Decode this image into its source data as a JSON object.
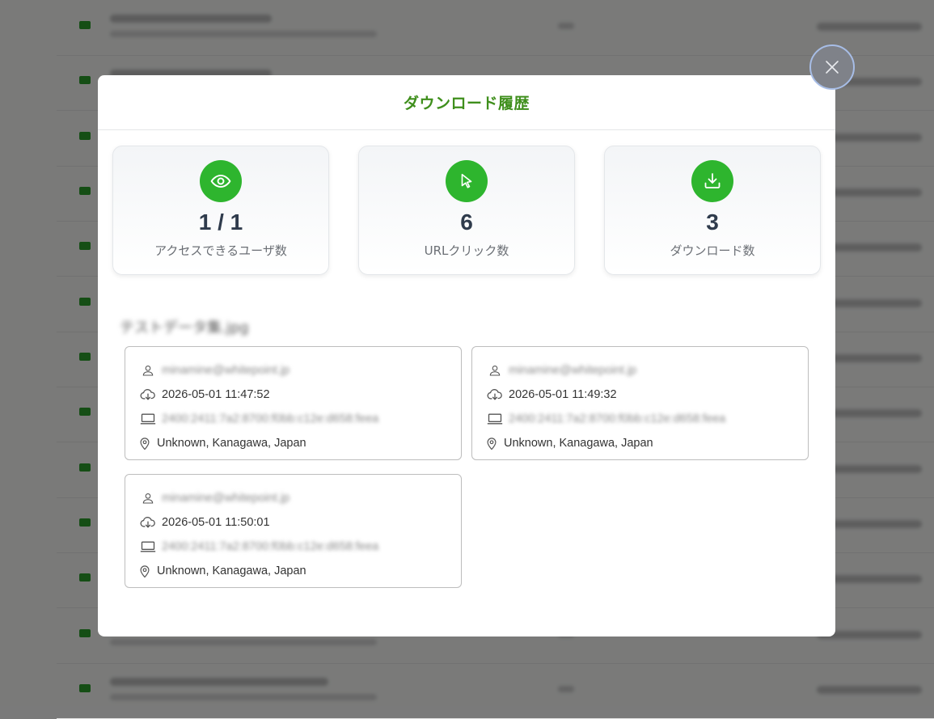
{
  "modal": {
    "title": "ダウンロード履歴"
  },
  "stats": [
    {
      "icon": "eye-icon",
      "value": "1 / 1",
      "label": "アクセスできるユーザ数"
    },
    {
      "icon": "cursor-icon",
      "value": "6",
      "label": "URLクリック数"
    },
    {
      "icon": "download-icon",
      "value": "3",
      "label": "ダウンロード数"
    }
  ],
  "file": {
    "name": "テストデータ集.jpg"
  },
  "downloads": [
    {
      "user": "minamine@whitepoint.jp",
      "datetime": "2026-05-01 11:47:52",
      "ip": "2400:2411:7a2:8700:f0bb:c12e:d658:feea",
      "location": "Unknown, Kanagawa, Japan"
    },
    {
      "user": "minamine@whitepoint.jp",
      "datetime": "2026-05-01 11:49:32",
      "ip": "2400:2411:7a2:8700:f0bb:c12e:d658:feea",
      "location": "Unknown, Kanagawa, Japan"
    },
    {
      "user": "minamine@whitepoint.jp",
      "datetime": "2026-05-01 11:50:01",
      "ip": "2400:2411:7a2:8700:f0bb:c12e:d658:feea",
      "location": "Unknown, Kanagawa, Japan"
    }
  ],
  "colors": {
    "accent": "#2eb52e",
    "title": "#3f8f1c",
    "value": "#2f3b4c"
  }
}
